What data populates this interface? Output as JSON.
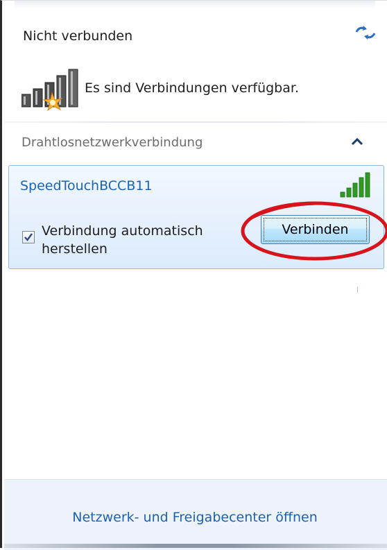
{
  "status": {
    "title": "Nicht verbunden",
    "availability_text": "Es sind Verbindungen verfügbar."
  },
  "icons": {
    "refresh": "refresh-icon",
    "availability": "network-available-icon",
    "collapse": "chevron-up-icon",
    "signal": "signal-strength-icon",
    "checkmark": "checkmark-icon"
  },
  "section": {
    "title": "Drahtlosnetzwerkverbindung"
  },
  "network": {
    "name": "SpeedTouchBCCB11",
    "signal_bars": 5,
    "auto_connect_label": "Verbindung automatisch herstellen",
    "auto_connect_checked": true,
    "connect_button_label": "Verbinden"
  },
  "footer": {
    "link_text": "Netzwerk- und Freigabecenter öffnen"
  },
  "colors": {
    "link_blue": "#1c64b4",
    "annotation_red": "#d7141c",
    "selection_bg": "#dcebfb",
    "signal_green": "#2f9b22"
  }
}
